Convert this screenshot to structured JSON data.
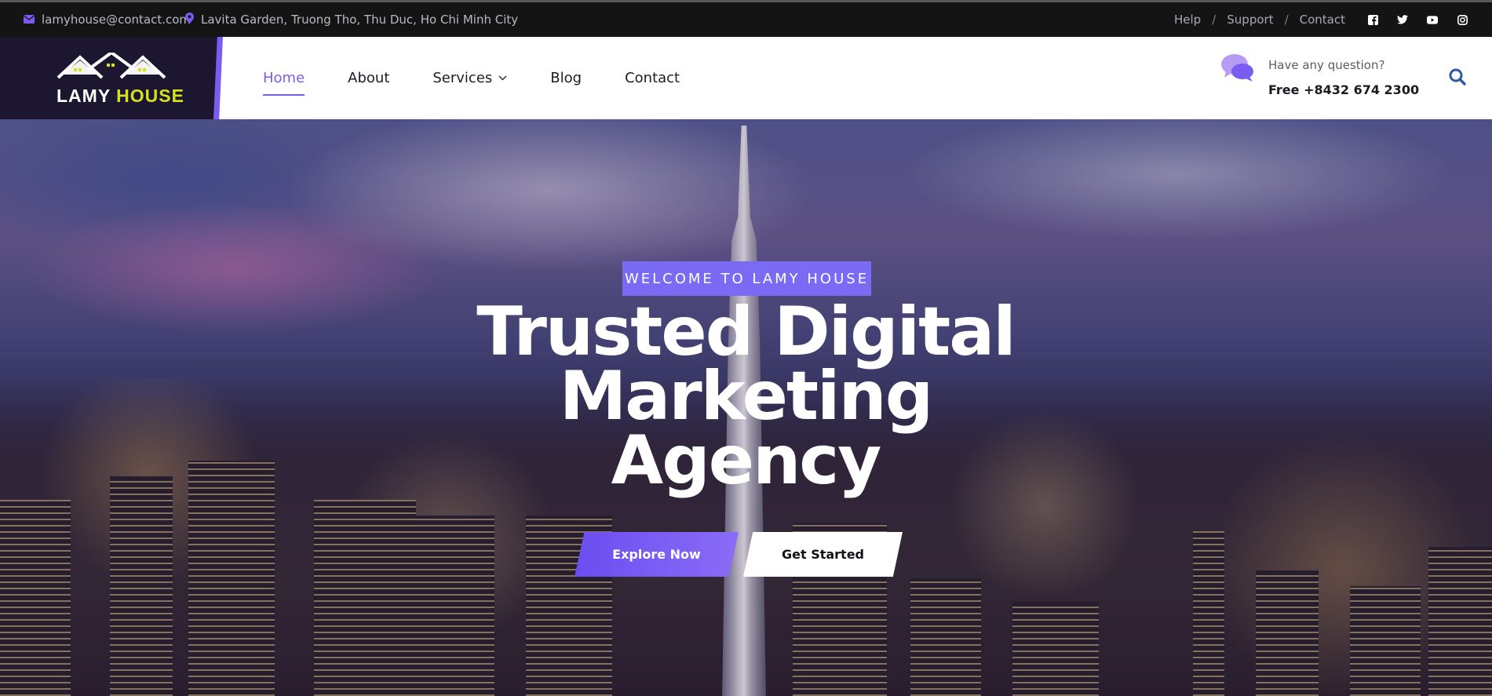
{
  "topbar": {
    "email": "lamyhouse@contact.com",
    "address": "Lavita Garden, Truong Tho, Thu Duc, Ho Chi Minh City",
    "links": [
      "Help",
      "Support",
      "Contact"
    ],
    "separator": "/",
    "social": [
      "facebook-icon",
      "twitter-icon",
      "youtube-icon",
      "instagram-icon"
    ]
  },
  "logo": {
    "word1": "LAMY",
    "word2": "HOUSE"
  },
  "nav": {
    "items": [
      {
        "label": "Home",
        "active": true
      },
      {
        "label": "About"
      },
      {
        "label": "Services",
        "has_dropdown": true
      },
      {
        "label": "Blog"
      },
      {
        "label": "Contact"
      }
    ]
  },
  "contact": {
    "question": "Have any question?",
    "phone": "Free +8432 674 2300"
  },
  "hero": {
    "badge": "WELCOME TO LAMY HOUSE",
    "title_line1": "Trusted Digital",
    "title_line2": "Marketing",
    "title_line3": "Agency",
    "primary_button": "Explore Now",
    "secondary_button": "Get Started"
  },
  "colors": {
    "accent": "#7b5cf0",
    "logo_yellow": "#d4e21c",
    "topbar_bg": "#141414"
  }
}
